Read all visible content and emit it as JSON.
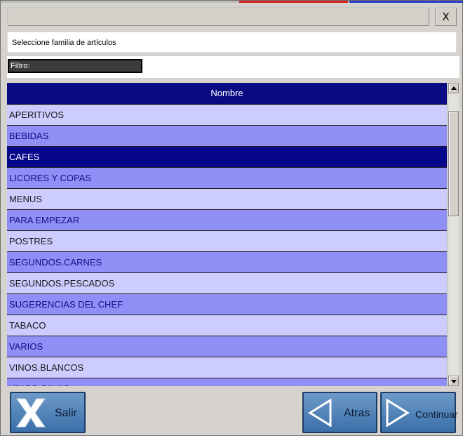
{
  "window": {
    "close_label": "X",
    "subtitle": "Seleccione familia de artículos",
    "filter_label": "Filtro:"
  },
  "grid": {
    "column_header": "Nombre",
    "rows": [
      {
        "label": "APERITIVOS",
        "style": "light"
      },
      {
        "label": "BEBIDAS",
        "style": "dark"
      },
      {
        "label": "CAFES",
        "style": "sel"
      },
      {
        "label": "LICORES Y COPAS",
        "style": "dark"
      },
      {
        "label": "MENUS",
        "style": "light"
      },
      {
        "label": "PARA EMPEZAR",
        "style": "dark"
      },
      {
        "label": "POSTRES",
        "style": "light"
      },
      {
        "label": "SEGUNDOS.CARNES",
        "style": "dark"
      },
      {
        "label": "SEGUNDOS.PESCADOS",
        "style": "light"
      },
      {
        "label": "SUGERENCIAS DEL CHEF",
        "style": "dark"
      },
      {
        "label": "TABACO",
        "style": "light"
      },
      {
        "label": "VARIOS",
        "style": "dark"
      },
      {
        "label": "VINOS.BLANCOS",
        "style": "light"
      },
      {
        "label": "VINOS.CAVAS",
        "style": "dark"
      }
    ]
  },
  "buttons": {
    "salir": "Salir",
    "atras": "Atras",
    "continuar": "Continuar"
  },
  "colors": {
    "header": "#0a0a82",
    "row_light": "#ccccff",
    "row_dark": "#8f8ff5",
    "row_selected": "#07078a",
    "button": "#4f82b8"
  }
}
